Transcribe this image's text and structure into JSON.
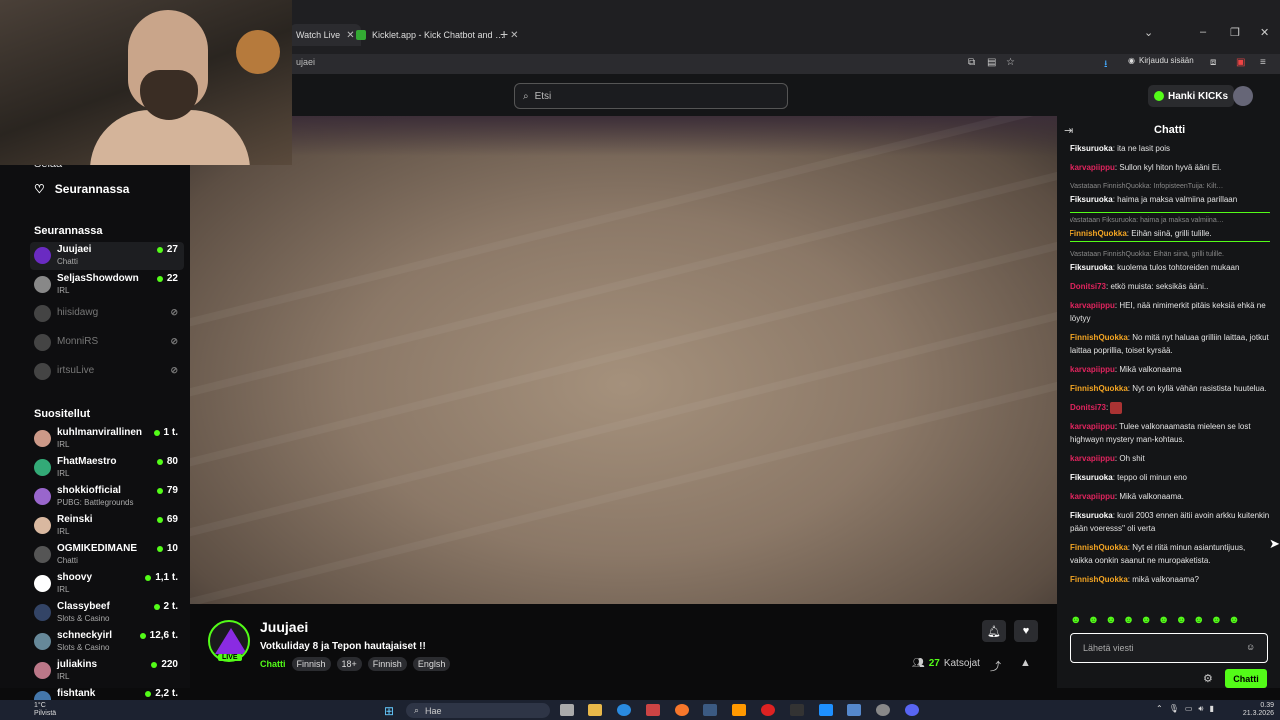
{
  "browser": {
    "tabs": [
      {
        "label": "Watch Live"
      },
      {
        "label": "Kicklet.app - Kick Chatbot and …"
      }
    ],
    "address": "ujaei",
    "signin_label": "Kirjaudu sisään"
  },
  "header": {
    "search_placeholder": "Etsi",
    "kicks_label": "Hanki KICKs"
  },
  "sidebar": {
    "top_item": "Selaa",
    "following_link": "Seurannassa",
    "following_header": "Seurannassa",
    "following": [
      {
        "name": "Juujaei",
        "category": "Chatti",
        "count": "27"
      },
      {
        "name": "SeljasShowdown",
        "category": "IRL",
        "count": "22"
      },
      {
        "name": "hiisidawg"
      },
      {
        "name": "MonniRS"
      },
      {
        "name": "irtsuLive"
      }
    ],
    "recommended_header": "Suositellut",
    "recommended": [
      {
        "name": "kuhlmanvirallinen",
        "category": "IRL",
        "count": "1 t."
      },
      {
        "name": "FhatMaestro",
        "category": "IRL",
        "count": "80"
      },
      {
        "name": "shokkiofficial",
        "category": "PUBG: Battlegrounds",
        "count": "79"
      },
      {
        "name": "Reinski",
        "category": "IRL",
        "count": "69"
      },
      {
        "name": "OGMIKEDIMANE",
        "category": "Chatti",
        "count": "10"
      },
      {
        "name": "shoovy",
        "category": "IRL",
        "count": "1,1 t."
      },
      {
        "name": "Classybeef",
        "category": "Slots & Casino",
        "count": "2 t."
      },
      {
        "name": "schneckyirl",
        "category": "Slots & Casino",
        "count": "12,6 t."
      },
      {
        "name": "juliakins",
        "category": "IRL",
        "count": "220"
      },
      {
        "name": "fishtank",
        "category": "",
        "count": "2,2 t."
      }
    ]
  },
  "stream": {
    "channel": "Juujaei",
    "live_badge": "LIVE",
    "title": "Votkuliday 8 ja Tepon hautajaiset !!",
    "category": "Chatti",
    "tags": [
      "Finnish",
      "18+",
      "Finnish",
      "Englsh"
    ],
    "viewers_count": "27",
    "viewers_label": "Katsojat"
  },
  "chat": {
    "header": "Chatti",
    "messages": [
      {
        "reply": "",
        "user": "Fiksuruoka",
        "color": "#ffffff",
        "text": "ita ne lasit pois"
      },
      {
        "reply": "",
        "user": "karvapiippu",
        "color": "#e0245e",
        "text": "Sullon kyl hiton hyvä ääni Ei."
      },
      {
        "reply": "Vastataan FinnishQuokka: InfopisteenTuija: Kilt…",
        "user": "Fiksuruoka",
        "color": "#ffffff",
        "text": "haima ja maksa valmiina parillaan"
      },
      {
        "reply": "Vastataan Fiksuruoka: haima ja maksa valmiina…",
        "user": "FinnishQuokka",
        "color": "#f5a623",
        "text": "Eihän siinä, grilli tulille.",
        "highlight": true
      },
      {
        "reply": "Vastataan FinnishQuokka: Eihän siinä, grilli tulille.",
        "user": "Fiksuruoka",
        "color": "#ffffff",
        "text": "kuolema tulos tohtoreiden mukaan"
      },
      {
        "reply": "",
        "user": "Donitsi73",
        "color": "#e0245e",
        "text": "etkö muista: seksikäs ääni.."
      },
      {
        "reply": "",
        "user": "karvapiippu",
        "color": "#e0245e",
        "text": "HEI, nää nimimerkit pitäis keksiä ehkä ne löytyy"
      },
      {
        "reply": "",
        "user": "FinnishQuokka",
        "color": "#f5a623",
        "text": "No mitä nyt haluaa grilliin laittaa, jotkut laittaa poprillia, toiset kyrsää."
      },
      {
        "reply": "",
        "user": "karvapiippu",
        "color": "#e0245e",
        "text": "Mikä valkonaama"
      },
      {
        "reply": "",
        "user": "FinnishQuokka",
        "color": "#f5a623",
        "text": "Nyt on kyllä vähän rasistista huutelua."
      },
      {
        "reply": "",
        "user": "Donitsi73",
        "color": "#e0245e",
        "text": ""
      },
      {
        "reply": "",
        "user": "karvapiippu",
        "color": "#e0245e",
        "text": "Tulee valkonaamasta mieleen se lost highwayn mystery man-kohtaus."
      },
      {
        "reply": "",
        "user": "karvapiippu",
        "color": "#e0245e",
        "text": "Oh shit"
      },
      {
        "reply": "",
        "user": "Fiksuruoka",
        "color": "#ffffff",
        "text": "teppo oli minun eno"
      },
      {
        "reply": "",
        "user": "karvapiippu",
        "color": "#e0245e",
        "text": "Mikä valkonaama."
      },
      {
        "reply": "",
        "user": "Fiksuruoka",
        "color": "#ffffff",
        "text": "kuoli 2003 ennen äitii avoin arkku kuitenkin pään voeresss'' oli verta"
      },
      {
        "reply": "",
        "user": "FinnishQuokka",
        "color": "#f5a623",
        "text": "Nyt ei riitä minun asiantuntijuus, vaikka oonkin saanut ne muropaketista."
      },
      {
        "reply": "",
        "user": "FinnishQuokka",
        "color": "#f5a623",
        "text": "mikä valkonaama?"
      }
    ],
    "input_placeholder": "Lähetä viesti",
    "send_label": "Chatti"
  },
  "taskbar": {
    "weather_temp": "1°C",
    "weather_desc": "Pilvistä",
    "search_label": "Hae",
    "time": "0.39",
    "date": "21.3.2026"
  },
  "colors": {
    "accent": "#53fc18",
    "background": "#0b0b0c",
    "panel": "#141517"
  }
}
